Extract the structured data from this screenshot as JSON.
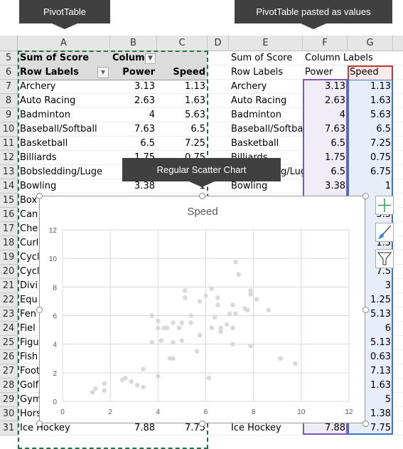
{
  "callouts": {
    "pivot": "PivotTable",
    "pasted": "PivotTable pasted as values",
    "scatter": "Regular Scatter Chart"
  },
  "columns": [
    "A",
    "B",
    "C",
    "D",
    "E",
    "F",
    "G"
  ],
  "row_numbers": [
    "5",
    "6",
    "7",
    "8",
    "9",
    "10",
    "11",
    "12",
    "13",
    "14",
    "15",
    "16",
    "17",
    "18",
    "19",
    "20",
    "21",
    "22",
    "23",
    "24",
    "25",
    "26",
    "27",
    "28",
    "29",
    "30",
    "31"
  ],
  "pivot": {
    "sum_label": "Sum of Score",
    "column_labels": "Column",
    "row_labels": "Row Labels",
    "headers": [
      "Power",
      "Speed"
    ],
    "rows": [
      [
        "Archery",
        "3.13",
        "1.13"
      ],
      [
        "Auto Racing",
        "2.63",
        "1.63"
      ],
      [
        "Badminton",
        "4",
        "5.63"
      ],
      [
        "Baseball/Softball",
        "7.63",
        "6.5"
      ],
      [
        "Basketball",
        "6.5",
        "7.25"
      ],
      [
        "Billiards",
        "1.75",
        "0.75"
      ],
      [
        "Bobsledding/Luge",
        "",
        ""
      ],
      [
        "Bowling",
        "3.38",
        "1"
      ],
      [
        "Box",
        "",
        ""
      ],
      [
        "Can",
        "",
        ""
      ],
      [
        "Che",
        "",
        ""
      ],
      [
        "Curl",
        "",
        ""
      ],
      [
        "Cycl",
        "",
        ""
      ],
      [
        "Cycl",
        "",
        ""
      ],
      [
        "Divi",
        "",
        ""
      ],
      [
        "Equ",
        "",
        ""
      ],
      [
        "Fen",
        "",
        ""
      ],
      [
        "Fiel",
        "",
        ""
      ],
      [
        "Figu",
        "",
        ""
      ],
      [
        "Fish",
        "",
        ""
      ],
      [
        "Foot",
        "",
        ""
      ],
      [
        "Golf",
        "",
        ""
      ],
      [
        "Gym",
        "",
        ""
      ],
      [
        "Hors",
        "",
        ""
      ],
      [
        "Ice Hockey",
        "7.88",
        "7.75"
      ]
    ]
  },
  "values": {
    "sum_label": "Sum of Score",
    "column_labels": "Column Labels",
    "row_labels": "Row Labels",
    "headers": [
      "Power",
      "Speed"
    ],
    "rows": [
      [
        "Archery",
        "3.13",
        "1.13"
      ],
      [
        "Auto Racing",
        "2.63",
        "1.63"
      ],
      [
        "Badminton",
        "4",
        "5.63"
      ],
      [
        "Baseball/Softbal",
        "7.63",
        "6.5"
      ],
      [
        "Basketball",
        "6.5",
        "7.25"
      ],
      [
        "Billiards",
        "1.75",
        "0.75"
      ],
      [
        "g/Lug",
        "6.5",
        "6.75"
      ],
      [
        "Bowling",
        "3.38",
        "1"
      ],
      [
        "",
        "",
        "6"
      ],
      [
        "",
        "",
        "5.5"
      ],
      [
        "",
        "",
        "2"
      ],
      [
        "",
        "",
        "1.5"
      ],
      [
        "",
        "",
        "5"
      ],
      [
        "",
        "",
        "7.5"
      ],
      [
        "",
        "",
        "3"
      ],
      [
        "",
        "",
        "1.25"
      ],
      [
        "",
        "",
        "5.13"
      ],
      [
        "",
        "",
        "6"
      ],
      [
        "",
        "",
        "5.13"
      ],
      [
        "",
        "",
        "0.63"
      ],
      [
        "",
        "",
        "7.13"
      ],
      [
        "",
        "",
        "1.63"
      ],
      [
        "",
        "",
        "5"
      ],
      [
        "",
        "",
        "1.38"
      ],
      [
        "Ice Hockey",
        "7.88",
        "7.75"
      ]
    ]
  },
  "colors": {
    "pivot_header": "#dcdcdc",
    "power_range": "#7e57c2",
    "speed_range": "#3c72c8",
    "series_name_range": "#c0393b",
    "marker": "#d9d9d9",
    "copy_border": "#217346"
  },
  "chart_data": {
    "type": "scatter",
    "title": "Speed",
    "xlim": [
      0,
      12
    ],
    "ylim": [
      0,
      12
    ],
    "xticks": [
      "0",
      "2",
      "4",
      "6",
      "8",
      "10",
      "12"
    ],
    "yticks": [
      "0",
      "2",
      "4",
      "6",
      "8",
      "10",
      "12"
    ],
    "grid": true,
    "points": [
      [
        1.25,
        0.63
      ],
      [
        1.38,
        0.88
      ],
      [
        1.75,
        1.25
      ],
      [
        1.75,
        0.75
      ],
      [
        2.5,
        1.5
      ],
      [
        2.63,
        1.63
      ],
      [
        2.88,
        1.38
      ],
      [
        3.13,
        1.13
      ],
      [
        3.38,
        1
      ],
      [
        3.38,
        2.25
      ],
      [
        3.75,
        6
      ],
      [
        3.75,
        4.13
      ],
      [
        4,
        5.63
      ],
      [
        4,
        5.13
      ],
      [
        4,
        1.75
      ],
      [
        4.13,
        4.25
      ],
      [
        4.25,
        5.13
      ],
      [
        4.38,
        5.13
      ],
      [
        4.5,
        3
      ],
      [
        4.63,
        3
      ],
      [
        4.63,
        5.5
      ],
      [
        4.63,
        4.13
      ],
      [
        4.88,
        5.13
      ],
      [
        5,
        5.5
      ],
      [
        5,
        4.25
      ],
      [
        5.13,
        7.75
      ],
      [
        5.13,
        7.25
      ],
      [
        5.38,
        6
      ],
      [
        5.38,
        5.5
      ],
      [
        5.63,
        3.5
      ],
      [
        5.75,
        7
      ],
      [
        5.75,
        4.63
      ],
      [
        6,
        7.38
      ],
      [
        6.13,
        1.63
      ],
      [
        6.25,
        7.88
      ],
      [
        6.25,
        5.13
      ],
      [
        6.38,
        5.88
      ],
      [
        6.5,
        7.25
      ],
      [
        6.5,
        6.75
      ],
      [
        6.63,
        5.13
      ],
      [
        6.63,
        4.88
      ],
      [
        6.88,
        5.38
      ],
      [
        7,
        6.13
      ],
      [
        7.13,
        6.75
      ],
      [
        7.13,
        5.13
      ],
      [
        7.13,
        4
      ],
      [
        7.25,
        9.75
      ],
      [
        7.25,
        6.13
      ],
      [
        7.38,
        8.88
      ],
      [
        7.63,
        6.5
      ],
      [
        7.75,
        6.38
      ],
      [
        7.88,
        7.75
      ],
      [
        7.88,
        7.5
      ],
      [
        7.88,
        3.88
      ],
      [
        8.13,
        7.13
      ],
      [
        8.63,
        6.38
      ],
      [
        9.13,
        3
      ],
      [
        9.75,
        2.63
      ]
    ]
  },
  "chart_buttons": {
    "elements": "plus-icon",
    "styles": "paintbrush-icon",
    "filters": "funnel-icon"
  }
}
